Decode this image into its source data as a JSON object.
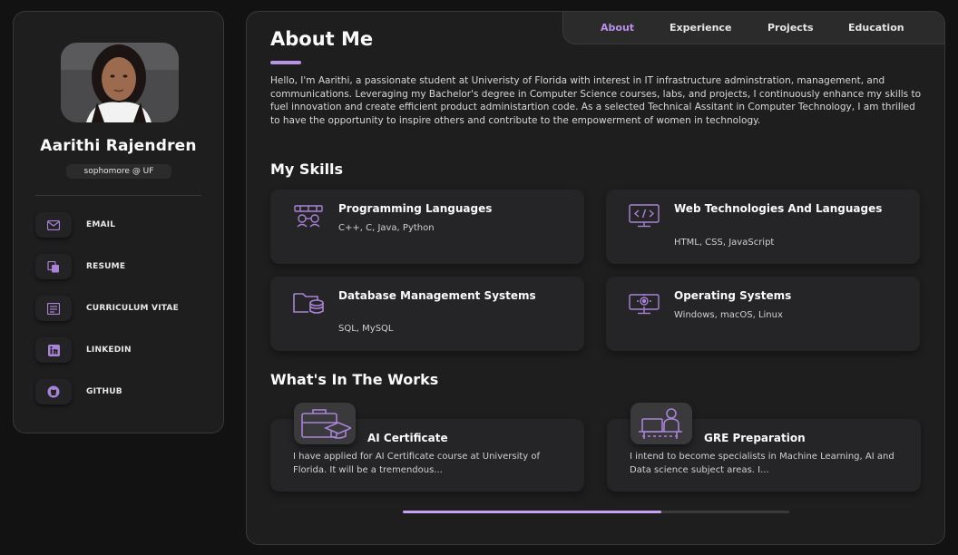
{
  "colors": {
    "accent": "#b992e8",
    "background": "#121212",
    "card": "#1e1e1f"
  },
  "profile": {
    "name": "Aarithi Rajendren",
    "title": "sophomore @ UF"
  },
  "contacts": [
    {
      "icon": "mail-icon",
      "label": "EMAIL"
    },
    {
      "icon": "resume-icon",
      "label": "RESUME"
    },
    {
      "icon": "cv-icon",
      "label": "CURRICULUM VITAE"
    },
    {
      "icon": "linkedin-icon",
      "label": "LINKEDIN"
    },
    {
      "icon": "github-icon",
      "label": "GITHUB"
    }
  ],
  "nav": {
    "active": "About",
    "links": [
      "About",
      "Experience",
      "Projects",
      "Education"
    ]
  },
  "about": {
    "title": "About Me",
    "text": "Hello, I'm Aarithi, a passionate student at Univeristy of Florida with interest in IT infrastructure adminstration, management, and communications. Leveraging my Bachelor's degree in Computer Science courses, labs, and projects, I continuously enhance my skills to fuel innovation and create efficient product administartion code. As a selected Technical Assitant in Computer Technology, I am thrilled to have the opportunity to inspire others and contribute to the empowerment of women in technology."
  },
  "skills": {
    "title": "My Skills",
    "items": [
      {
        "icon": "programming-icon",
        "title": "Programming Languages",
        "desc": "C++, C, Java, Python"
      },
      {
        "icon": "web-code-icon",
        "title": "Web Technologies And Languages",
        "desc": "HTML, CSS, JavaScript"
      },
      {
        "icon": "database-icon",
        "title": "Database Management Systems",
        "desc": "SQL, MySQL"
      },
      {
        "icon": "os-icon",
        "title": "Operating Systems",
        "desc": "Windows, macOS, Linux"
      }
    ]
  },
  "works": {
    "title": "What's In The Works",
    "items": [
      {
        "icon": "briefcase-graduation-icon",
        "title": "AI Certificate",
        "desc": "I have applied for AI Certificate course at University of Florida. It will be a tremendous..."
      },
      {
        "icon": "student-desk-icon",
        "title": "GRE Preparation",
        "desc": "I intend to become specialists in Machine Learning, AI and Data science subject areas. I..."
      }
    ],
    "scroll_progress": 0.67
  }
}
